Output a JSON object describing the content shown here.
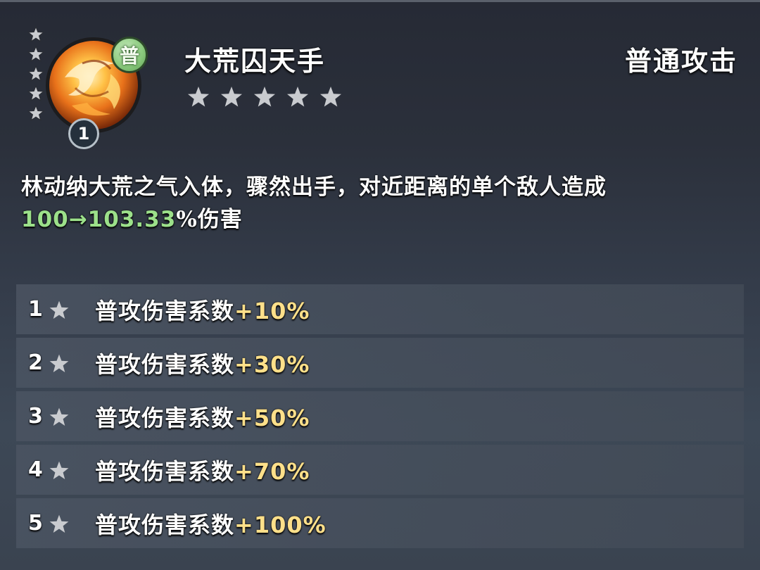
{
  "skill": {
    "name": "大荒囚天手",
    "type": "普通攻击",
    "badge": "普",
    "level": "1",
    "rating_stars": 5,
    "side_stars": 5,
    "icon": "fire-swirl-skill-icon"
  },
  "description": {
    "text": "林动纳大荒之气入体，骤然出手，对近距离的单个敌人造成",
    "value": "100→103.33",
    "suffix": "%伤害"
  },
  "upgrades": [
    {
      "num": "1",
      "label": "普攻伤害系数",
      "value": "+10%"
    },
    {
      "num": "2",
      "label": "普攻伤害系数",
      "value": "+30%"
    },
    {
      "num": "3",
      "label": "普攻伤害系数",
      "value": "+50%"
    },
    {
      "num": "4",
      "label": "普攻伤害系数",
      "value": "+70%"
    },
    {
      "num": "5",
      "label": "普攻伤害系数",
      "value": "+100%"
    }
  ],
  "colors": {
    "value_green": "#9ce08a",
    "value_gold": "#ffe08a",
    "badge_green": "#8ccb7f",
    "star_gray": "#c9cbcf"
  }
}
